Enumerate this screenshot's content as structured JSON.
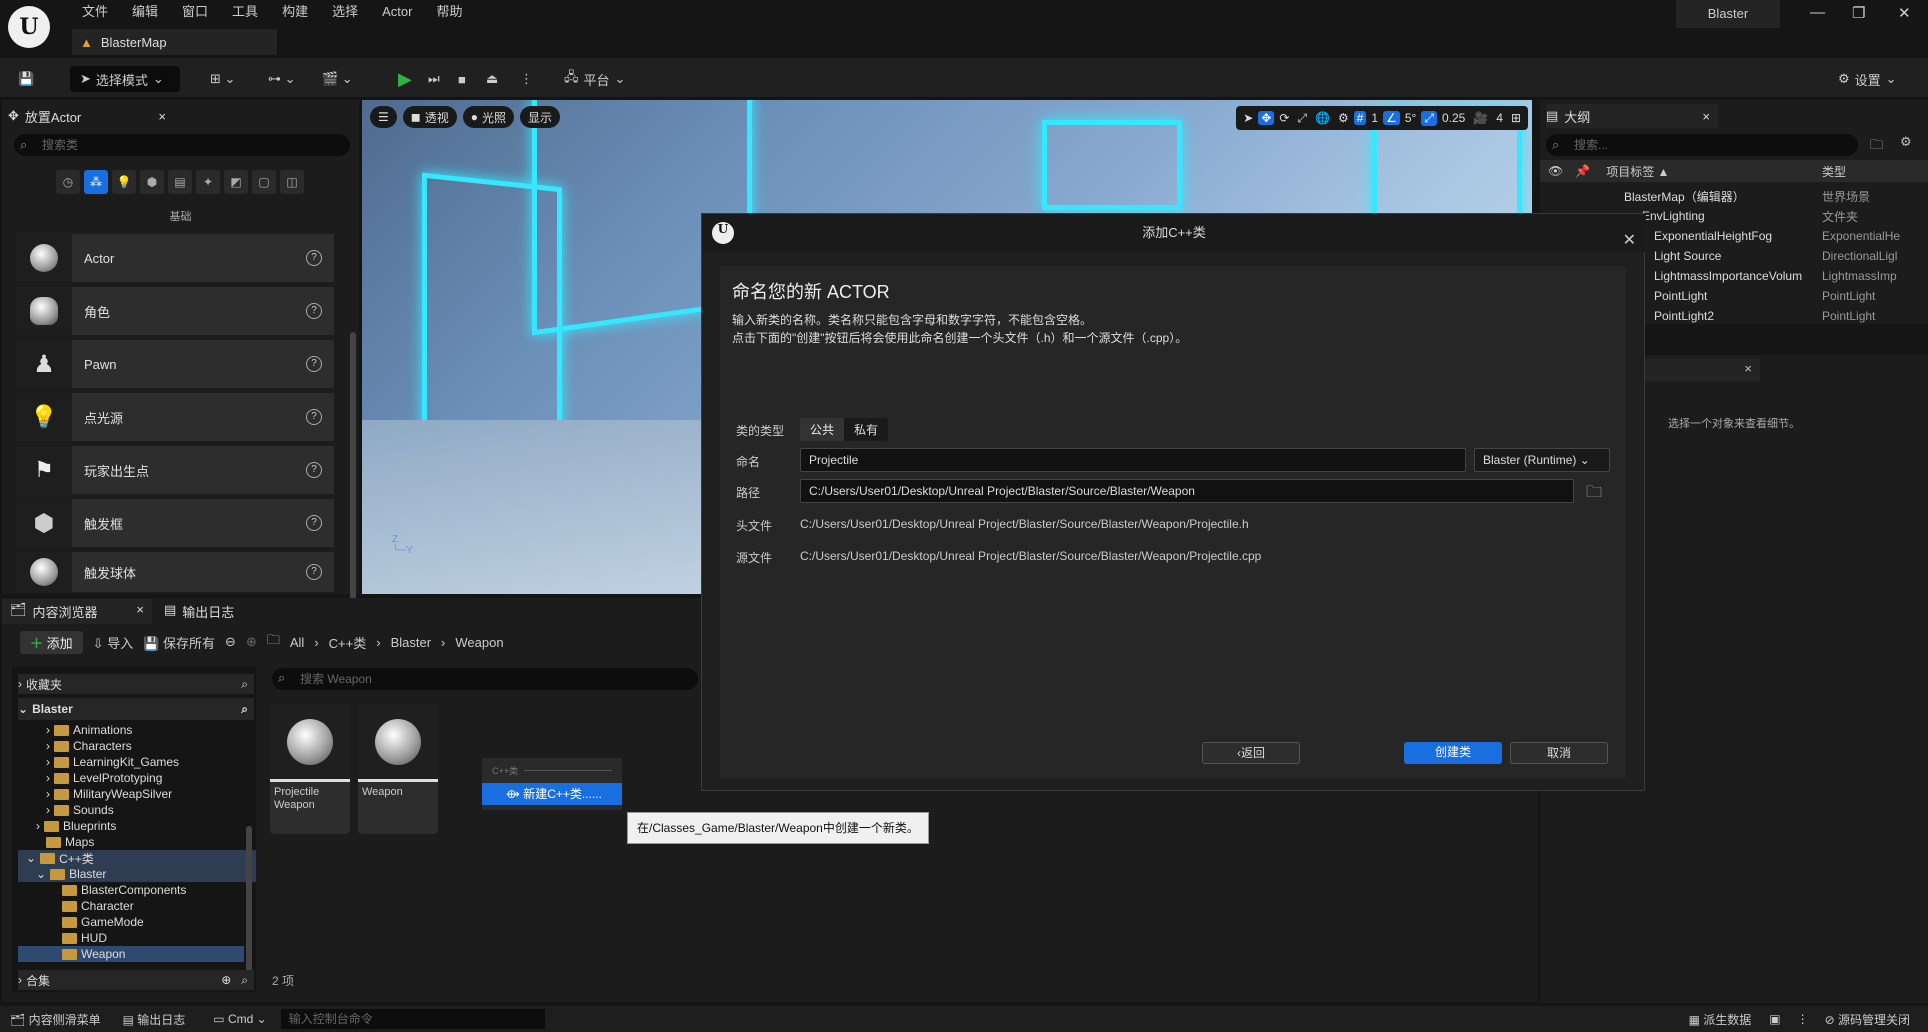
{
  "menu": [
    "文件",
    "编辑",
    "窗口",
    "工具",
    "构建",
    "选择",
    "Actor",
    "帮助"
  ],
  "map_tab": "BlasterMap",
  "window_title": "Blaster",
  "toolbar": {
    "mode": "选择模式",
    "platform": "平台",
    "settings": "设置"
  },
  "place_actors": {
    "tab": "放置Actor",
    "search_placeholder": "搜索类",
    "category": "基础",
    "items": [
      "Actor",
      "角色",
      "Pawn",
      "点光源",
      "玩家出生点",
      "触发框",
      "触发球体"
    ]
  },
  "viewport": {
    "perspective": "透视",
    "lit": "光照",
    "show": "显示",
    "grid": "1",
    "angle": "5°",
    "scale": "0.25",
    "camera": "4"
  },
  "outliner": {
    "tab": "大纲",
    "search_placeholder": "搜索...",
    "col_label": "项目标签 ▲",
    "col_type": "类型",
    "rows": [
      {
        "name": "BlasterMap（编辑器）",
        "type": "世界场景"
      },
      {
        "name": "EnvLighting",
        "type": "文件夹"
      },
      {
        "name": "ExponentialHeightFog",
        "type": "ExponentialHe"
      },
      {
        "name": "Light Source",
        "type": "DirectionalLigl"
      },
      {
        "name": "LightmassImportanceVolum",
        "type": "LightmassImp"
      },
      {
        "name": "PointLight",
        "type": "PointLight"
      },
      {
        "name": "PointLight2",
        "type": "PointLight"
      }
    ]
  },
  "details": {
    "empty_text": "选择一个对象来查看细节。"
  },
  "content_browser": {
    "tab": "内容浏览器",
    "log_tab": "输出日志",
    "add": "添加",
    "import": "导入",
    "save_all": "保存所有",
    "breadcrumbs": [
      "All",
      "C++类",
      "Blaster",
      "Weapon"
    ],
    "favorites": "收藏夹",
    "root": "Blaster",
    "tree": [
      "Animations",
      "Characters",
      "LearningKit_Games",
      "LevelPrototyping",
      "MilitaryWeapSilver",
      "Sounds",
      "Blueprints",
      "Maps",
      "C++类",
      "Blaster",
      "BlasterComponents",
      "Character",
      "GameMode",
      "HUD",
      "Weapon"
    ],
    "collections": "合集",
    "search_placeholder": "搜索 Weapon",
    "assets": [
      {
        "name": "Projectile\nWeapon"
      },
      {
        "name": "Weapon"
      }
    ],
    "count": "2 项",
    "context_header": "C++类",
    "context_item": "新建C++类......",
    "tooltip": "在/Classes_Game/Blaster/Weapon中创建一个新类。"
  },
  "status": {
    "drawer": "内容侧滑菜单",
    "log": "输出日志",
    "cmd": "Cmd",
    "console_placeholder": "输入控制台命令",
    "derived": "派生数据",
    "source_control": "源码管理关闭"
  },
  "dialog": {
    "title": "添加C++类",
    "heading": "命名您的新 ACTOR",
    "line1": "输入新类的名称。类名称只能包含字母和数字字符，不能包含空格。",
    "line2": "点击下面的\"创建\"按钮后将会使用此命名创建一个头文件（.h）和一个源文件（.cpp）。",
    "type_label": "类的类型",
    "public": "公共",
    "private": "私有",
    "name_label": "命名",
    "name_value": "Projectile",
    "module": "Blaster (Runtime)",
    "path_label": "路径",
    "path_value": "C:/Users/User01/Desktop/Unreal Project/Blaster/Source/Blaster/Weapon",
    "header_label": "头文件",
    "header_value": "C:/Users/User01/Desktop/Unreal Project/Blaster/Source/Blaster/Weapon/Projectile.h",
    "source_label": "源文件",
    "source_value": "C:/Users/User01/Desktop/Unreal Project/Blaster/Source/Blaster/Weapon/Projectile.cpp",
    "back": "返回",
    "create": "创建类",
    "cancel": "取消"
  },
  "colors": {
    "accent": "#1a6fe0",
    "play": "#31b046",
    "neon": "#36e8ff"
  }
}
